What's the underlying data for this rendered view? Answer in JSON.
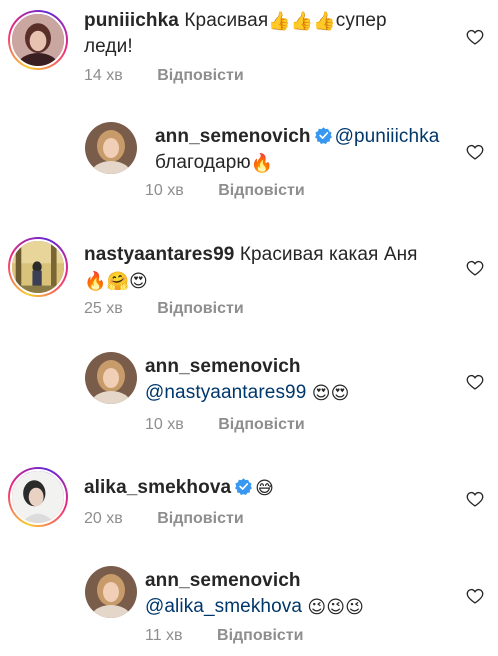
{
  "comments": [
    {
      "username": "puniiichka",
      "text_1": "Красивая",
      "emoji_1": "👍👍👍",
      "text_2": "супер",
      "text_3": "леди!",
      "time": "14 хв",
      "reply_label": "Відповісти",
      "verified": false
    },
    {
      "username": "ann_semenovich",
      "mention": "@puniiichka",
      "text_1": "благодарю",
      "emoji_1": "🔥",
      "time": "10 хв",
      "reply_label": "Відповісти",
      "verified": true
    },
    {
      "username": "nastyaantares99",
      "text_1": "Красивая какая Аня",
      "emoji_1": "🔥🤗😍",
      "time": "25 хв",
      "reply_label": "Відповісти",
      "verified": false
    },
    {
      "username": "ann_semenovich",
      "mention": "@nastyaantares99",
      "emoji_1": "😍😍",
      "time": "10 хв",
      "reply_label": "Відповісти",
      "verified": false
    },
    {
      "username": "alika_smekhova",
      "emoji_1": "😅",
      "time": "20 хв",
      "reply_label": "Відповісти",
      "verified": true
    },
    {
      "username": "ann_semenovich",
      "mention": "@alika_smekhova",
      "emoji_1": "😉😉😉",
      "time": "11 хв",
      "reply_label": "Відповісти",
      "verified": false
    }
  ],
  "colors": {
    "verified_blue": "#3897f0",
    "meta_gray": "#8e8e8e",
    "mention_blue": "#00376b"
  },
  "icons": {
    "like": "heart-outline-icon",
    "verified": "verified-badge-icon"
  }
}
